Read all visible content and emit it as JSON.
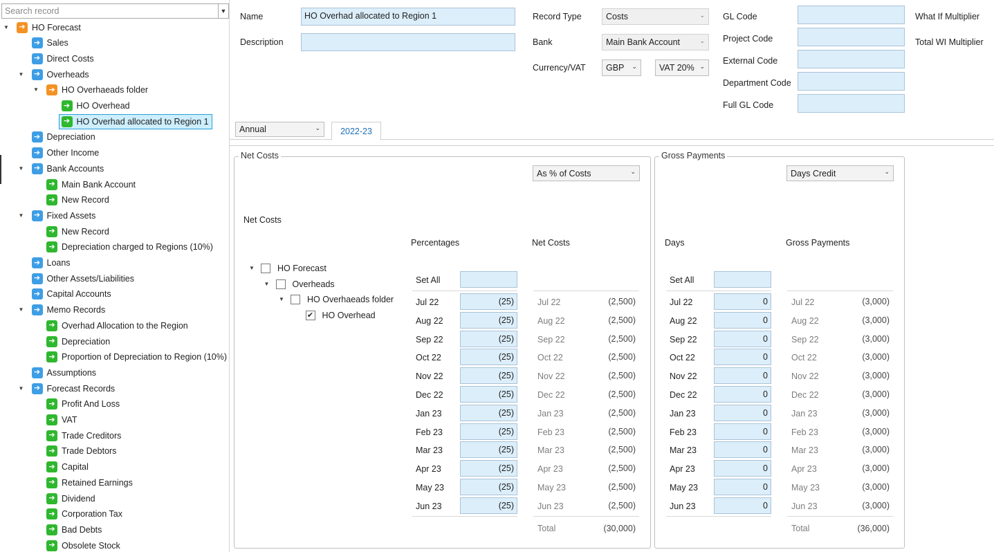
{
  "sidebar": {
    "search_placeholder": "Search record",
    "tree": [
      {
        "label": "HO Forecast",
        "icon": "orange",
        "level": 0,
        "expanded": true
      },
      {
        "label": "Sales",
        "icon": "blue",
        "level": 1
      },
      {
        "label": "Direct Costs",
        "icon": "blue",
        "level": 1
      },
      {
        "label": "Overheads",
        "icon": "blue",
        "level": 1,
        "expanded": true
      },
      {
        "label": "HO Overhaeads folder",
        "icon": "orange",
        "level": 2,
        "expanded": true
      },
      {
        "label": "HO Overhead",
        "icon": "green",
        "level": 3
      },
      {
        "label": "HO Overhad allocated to Region 1",
        "icon": "green",
        "level": 3,
        "selected": true
      },
      {
        "label": "Depreciation",
        "icon": "blue",
        "level": 1
      },
      {
        "label": "Other Income",
        "icon": "blue",
        "level": 1
      },
      {
        "label": "Bank Accounts",
        "icon": "blue",
        "level": 1,
        "expanded": true
      },
      {
        "label": "Main Bank Account",
        "icon": "green",
        "level": 2
      },
      {
        "label": "New Record",
        "icon": "green",
        "level": 2
      },
      {
        "label": "Fixed Assets",
        "icon": "blue",
        "level": 1,
        "expanded": true
      },
      {
        "label": "New Record",
        "icon": "green",
        "level": 2
      },
      {
        "label": "Depreciation charged to Regions (10%)",
        "icon": "green",
        "level": 2
      },
      {
        "label": "Loans",
        "icon": "blue",
        "level": 1
      },
      {
        "label": "Other Assets/Liabilities",
        "icon": "blue",
        "level": 1
      },
      {
        "label": "Capital Accounts",
        "icon": "blue",
        "level": 1
      },
      {
        "label": "Memo Records",
        "icon": "blue",
        "level": 1,
        "expanded": true
      },
      {
        "label": "Overhad Allocation to  the  Region",
        "icon": "green",
        "level": 2
      },
      {
        "label": "Depreciation",
        "icon": "green",
        "level": 2
      },
      {
        "label": "Proportion of Depreciation to Region (10%)",
        "icon": "green",
        "level": 2
      },
      {
        "label": "Assumptions",
        "icon": "blue",
        "level": 1
      },
      {
        "label": "Forecast Records",
        "icon": "blue",
        "level": 1,
        "expanded": true
      },
      {
        "label": "Profit And Loss",
        "icon": "green",
        "level": 2
      },
      {
        "label": "VAT",
        "icon": "green",
        "level": 2
      },
      {
        "label": "Trade Creditors",
        "icon": "green",
        "level": 2
      },
      {
        "label": "Trade Debtors",
        "icon": "green",
        "level": 2
      },
      {
        "label": "Capital",
        "icon": "green",
        "level": 2
      },
      {
        "label": "Retained Earnings",
        "icon": "green",
        "level": 2
      },
      {
        "label": "Dividend",
        "icon": "green",
        "level": 2
      },
      {
        "label": "Corporation Tax",
        "icon": "green",
        "level": 2
      },
      {
        "label": "Bad Debts",
        "icon": "green",
        "level": 2
      },
      {
        "label": "Obsolete Stock",
        "icon": "green",
        "level": 2
      }
    ]
  },
  "form": {
    "name_label": "Name",
    "name_value": "HO Overhad allocated to Region 1",
    "description_label": "Description",
    "description_value": "",
    "record_type_label": "Record Type",
    "record_type_value": "Costs",
    "bank_label": "Bank",
    "bank_value": "Main Bank Account",
    "currency_vat_label": "Currency/VAT",
    "currency_value": "GBP",
    "vat_value": "VAT 20%",
    "gl_code_label": "GL Code",
    "project_code_label": "Project Code",
    "external_code_label": "External Code",
    "department_code_label": "Department Code",
    "full_gl_code_label": "Full GL Code",
    "what_if_multiplier_label": "What If Multiplier",
    "total_wi_multiplier_label": "Total WI Multiplier"
  },
  "period_select": "Annual",
  "tabs": [
    {
      "label": "2022-23",
      "active": true
    }
  ],
  "net_costs": {
    "group_title": "Net Costs",
    "mode_select": "As % of Costs",
    "section_label": "Net Costs",
    "percentages_header": "Percentages",
    "net_costs_header": "Net Costs",
    "set_all_label": "Set All",
    "check_tree": [
      {
        "label": "HO Forecast",
        "level": 0,
        "checked": false
      },
      {
        "label": "Overheads",
        "level": 1,
        "checked": false
      },
      {
        "label": "HO Overhaeads folder",
        "level": 2,
        "checked": false
      },
      {
        "label": "HO Overhead",
        "level": 3,
        "checked": true
      }
    ],
    "months": [
      "Jul 22",
      "Aug 22",
      "Sep 22",
      "Oct 22",
      "Nov 22",
      "Dec 22",
      "Jan 23",
      "Feb 23",
      "Mar 23",
      "Apr 23",
      "May 23",
      "Jun 23"
    ],
    "percentages": [
      "(25)",
      "(25)",
      "(25)",
      "(25)",
      "(25)",
      "(25)",
      "(25)",
      "(25)",
      "(25)",
      "(25)",
      "(25)",
      "(25)"
    ],
    "values": [
      "(2,500)",
      "(2,500)",
      "(2,500)",
      "(2,500)",
      "(2,500)",
      "(2,500)",
      "(2,500)",
      "(2,500)",
      "(2,500)",
      "(2,500)",
      "(2,500)",
      "(2,500)"
    ],
    "total_label": "Total",
    "total_value": "(30,000)"
  },
  "gross_payments": {
    "group_title": "Gross Payments",
    "mode_select": "Days Credit",
    "days_header": "Days",
    "gross_payments_header": "Gross Payments",
    "set_all_label": "Set All",
    "days": [
      "0",
      "0",
      "0",
      "0",
      "0",
      "0",
      "0",
      "0",
      "0",
      "0",
      "0",
      "0"
    ],
    "values": [
      "(3,000)",
      "(3,000)",
      "(3,000)",
      "(3,000)",
      "(3,000)",
      "(3,000)",
      "(3,000)",
      "(3,000)",
      "(3,000)",
      "(3,000)",
      "(3,000)",
      "(3,000)"
    ],
    "total_label": "Total",
    "total_value": "(36,000)"
  }
}
